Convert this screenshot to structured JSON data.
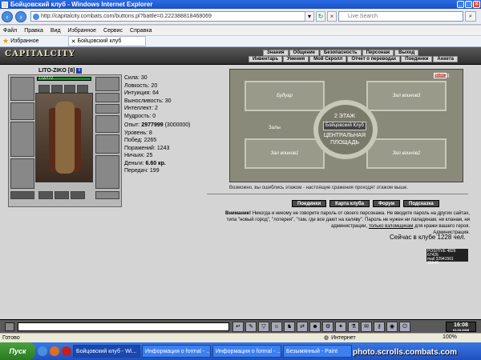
{
  "window": {
    "title": "Бойцовский клуб - Windows Internet Explorer"
  },
  "browser": {
    "url": "http://capitalcity.combats.com/buttons.pl?battle=0.222388818468069",
    "search_placeholder": "Live Search",
    "menu": [
      "Файл",
      "Правка",
      "Вид",
      "Избранное",
      "Сервис",
      "Справка"
    ],
    "favorites_label": "Избранное",
    "tab_title": "Бойцовский клуб"
  },
  "game": {
    "logo": "CAPITALCITY",
    "top_menu_1": [
      "Знания",
      "Общение",
      "Безопасность",
      "Персонаж",
      "Выход"
    ],
    "top_menu_2": [
      "Инвентарь",
      "Умения",
      "Мой Скролл",
      "Отчет о переводах",
      "Поединки",
      "Анкета"
    ],
    "character": {
      "name": "LITO-ZIKO",
      "level": "[8]",
      "info_icon": "i",
      "hp": "772/772"
    },
    "stats": [
      "Сила: 30",
      "Ловкость: 20",
      "Интуиция: 64",
      "Выносливость: 30",
      "Интеллект: 2",
      "Мудрость: 0"
    ],
    "experience": {
      "label": "Опыт:",
      "value": "2977999",
      "next": "(3000000)"
    },
    "stats2": [
      "Уровень: 8",
      "Побед: 2265",
      "Поражений: 1243",
      "Ничьих: 25"
    ],
    "money": {
      "label": "Деньги:",
      "value": "6.60 кр."
    },
    "transfers": "Передач: 199",
    "map": {
      "rooms": [
        "Будуар",
        "Зал воинов3",
        "Залы",
        "Зал воинов1",
        "Зал воинов2"
      ],
      "center_top": "2 ЭТАЖ",
      "center_name": "Бойцовский Клуб",
      "center_bottom": "ЦЕНТРАЛЬНАЯ ПЛОЩАДЬ",
      "exit_label": "ВЫХОД"
    },
    "map_message": "Возможно, вы ошиблись этажом - настоящие сражения проходят этажом выше.",
    "buttons": [
      "Поединки",
      "Карта клуба",
      "Форум",
      "Подсказка"
    ],
    "warning": {
      "title": "Внимание!",
      "text": "Никогда и никому не говорите пароль от своего персонажа. Не вводите пароль на других сайтах, типа \"новый город\", \"лотерея\", \"там, где все дают на халяву\". Пароль не нужен ни паладинам, ни кланам, ни администрации,",
      "link": "только взломщикам",
      "text_end": "для кражи вашего героя.",
      "sign": "Администрация."
    },
    "online": "Сейчас в клубе 1228 чел.",
    "counter_lines": [
      "POSITIVE 4826 67426",
      "mail 32941561",
      "36149"
    ],
    "clock": {
      "time": "16:08",
      "date": "01.03.2008"
    }
  },
  "statusbar": {
    "left": "Готово",
    "zone": "Интернет",
    "zoom": "100%"
  },
  "taskbar": {
    "start": "Пуск",
    "tasks": [
      "Бойцовский клуб - Wi...",
      "Информация о formal - ...",
      "Информация о formal - ...",
      "Безымянный - Paint"
    ]
  },
  "watermark": "photo.scrolls.combats.com"
}
